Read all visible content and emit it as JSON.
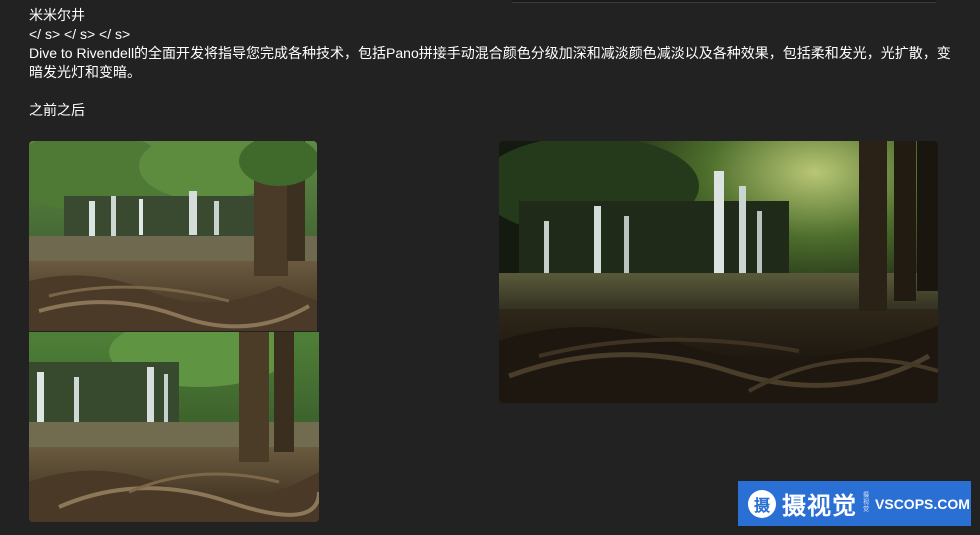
{
  "article": {
    "title": "米米尔井",
    "tags_line": "</ s> </ s> </ s>",
    "description": "Dive to Rivendell的全面开发将指导您完成各种技术，包括Pano拼接手动混合颜色分级加深和减淡颜色减淡以及各种效果，包括柔和发光，光扩散，变暗发光灯和变暗。",
    "before_after_label": "之前之后",
    "cut_off_text": "… …"
  },
  "images": {
    "before_1": {
      "icon": "waterfall-photo-before-wide"
    },
    "before_2": {
      "icon": "waterfall-photo-before-close"
    },
    "after": {
      "icon": "waterfall-photo-after"
    }
  },
  "watermark": {
    "badge": "摄",
    "brand_cn": "摄视觉",
    "brand_en": "VSCOPS.COM",
    "mini_lines": [
      "摄",
      "视",
      "觉"
    ],
    "color": "#2a6fd4"
  },
  "colors": {
    "background": "#222222",
    "text": "#ffffff"
  }
}
